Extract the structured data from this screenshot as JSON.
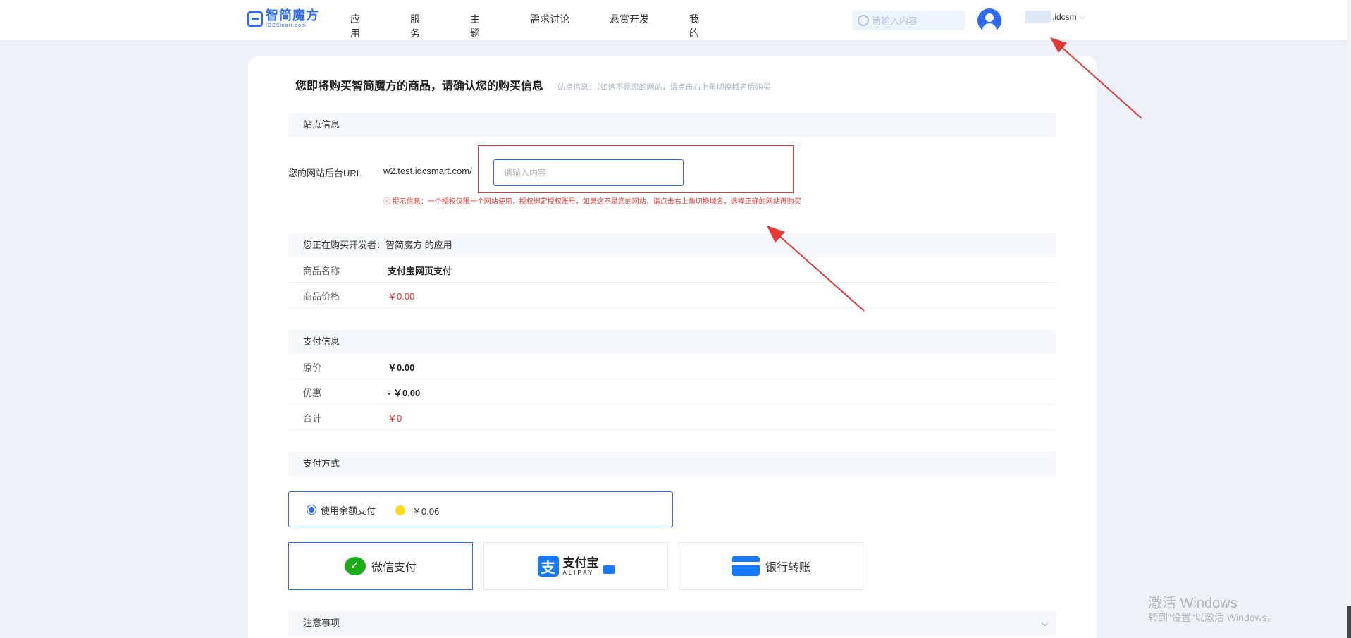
{
  "header": {
    "logo_cn": "智简魔方",
    "logo_en": "IDCSmart.com",
    "nav": [
      "应用",
      "服务",
      "主题",
      "需求讨论",
      "悬赏开发",
      "我的"
    ],
    "search_placeholder": "请输入内容",
    "user_name": ".idcsm",
    "user_chevron": "⌵"
  },
  "page": {
    "title": "您即将购买智简魔方的商品，请确认您的购买信息",
    "title_note": "站点信息：（如这不是您的网站，请点击右上角切换域名后购买"
  },
  "site_info": {
    "heading": "站点信息",
    "url_label": "您的网站后台URL",
    "url_prefix": "w2.test.idcsmart.com/",
    "url_placeholder": "请输入内容",
    "url_value": "",
    "warning": "ⓘ 提示信息：一个授权仅限一个网站使用，授权绑定授权账号，如果这不是您的网站，请点击右上角切换域名，选择正确的网站再购买"
  },
  "product": {
    "heading": "您正在购买开发者：智简魔方 的应用",
    "rows": [
      {
        "key": "商品名称",
        "value": "支付宝网页支付"
      },
      {
        "key": "商品价格",
        "value": "￥0.00"
      }
    ]
  },
  "payment_info": {
    "heading": "支付信息",
    "rows": [
      {
        "key": "原价",
        "value": "￥0.00"
      },
      {
        "key": "优惠",
        "value": "- ￥0.00"
      },
      {
        "key": "合计",
        "value": "￥0"
      }
    ]
  },
  "payment_method": {
    "heading": "支付方式",
    "balance_label": "使用余额支付",
    "balance_amount": "￥0.06",
    "options": {
      "wechat": "微信支付",
      "alipay_cn": "支付宝",
      "alipay_en": "ALIPAY",
      "alipay_icon_char": "支",
      "bank": "银行转账"
    }
  },
  "notice": {
    "heading": "注意事项",
    "chevron": "⌵"
  },
  "watermark": {
    "line1": "激活 Windows",
    "line2": "转到\"设置\"以激活 Windows。"
  },
  "colors": {
    "brand": "#2f6bf1",
    "price_red": "#f5222d",
    "annotation_red": "#e53935",
    "wechat_green": "#1aad19",
    "alipay_blue": "#1677ff"
  }
}
